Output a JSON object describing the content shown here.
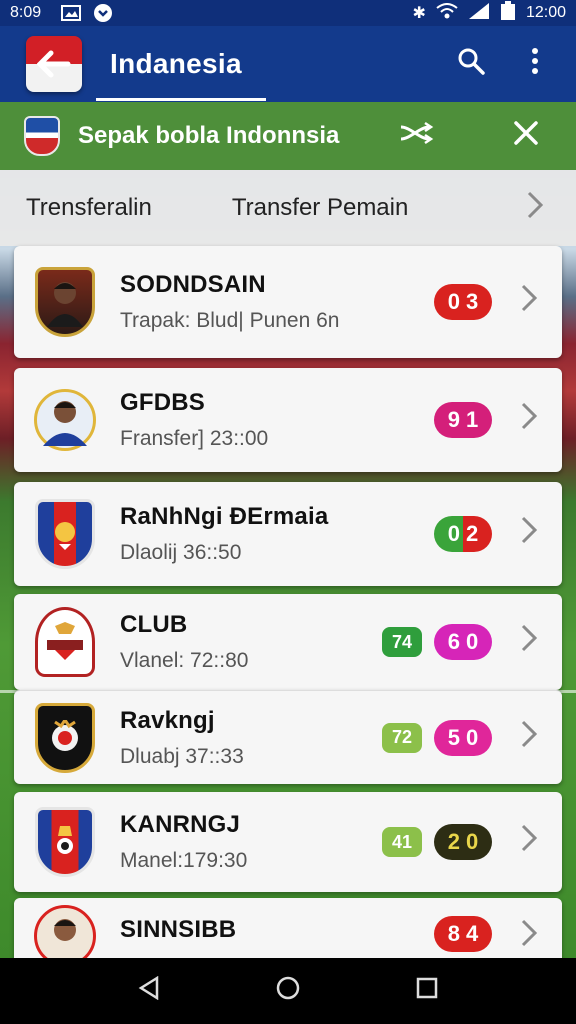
{
  "status_bar": {
    "time": "8:09",
    "clock": "12:00",
    "icons": [
      "gallery-icon",
      "chevron-circle-icon",
      "bluetooth-icon",
      "wifi-icon",
      "signal-icon",
      "battery-icon"
    ]
  },
  "app_bar": {
    "title": "Indanesia",
    "icons": [
      "search-icon",
      "more-vert-icon"
    ]
  },
  "section_header": {
    "title": "Sepak bobla Indonnsia",
    "icons": [
      "shuffle-icon",
      "close-icon"
    ]
  },
  "tabs": {
    "left": "Trensferalin",
    "right": "Transfer Pemain"
  },
  "items": [
    {
      "name": "SODNDSAIN",
      "sub": "Trapak: Blud| Punen 6n",
      "badges": [
        {
          "text": "0 3",
          "color": "#d9221f"
        }
      ],
      "logo": "player-photo"
    },
    {
      "name": "GFDBS",
      "sub": "Fransfer] 23::00",
      "badges": [
        {
          "text": "9 1",
          "color": "#d41f7a"
        }
      ],
      "logo": "player-photo"
    },
    {
      "name": "RaNhNgi ÐErmaia",
      "sub": "Dlaolij 36::50",
      "badges": [
        {
          "text": "0 2",
          "color": "#3aa43a",
          "split_color": "#d9221f"
        }
      ],
      "logo": "club-crest"
    },
    {
      "name": "CLUB",
      "sub": "Vlanel: 72::80",
      "badges": [
        {
          "text": "74",
          "color": "#2f9e3c",
          "small": true
        },
        {
          "text": "6 0",
          "color": "#d625b8"
        }
      ],
      "logo": "club-crest"
    },
    {
      "name": "Ravkngj",
      "sub": "Dluabj 37::33",
      "badges": [
        {
          "text": "72",
          "color": "#8cc04a",
          "small": true
        },
        {
          "text": "5 0",
          "color": "#e0269a"
        }
      ],
      "logo": "club-crest"
    },
    {
      "name": "KANRNGJ",
      "sub": "Manel:179:30",
      "badges": [
        {
          "text": "41",
          "color": "#8cc04a",
          "small": true
        },
        {
          "text": "2 0",
          "color": "#2d2d14",
          "text_color": "#e9d64b"
        }
      ],
      "logo": "club-crest"
    },
    {
      "name": "SINNSIBB",
      "sub": "",
      "badges": [
        {
          "text": "8 4",
          "color": "#d9221f"
        }
      ],
      "logo": "player-photo"
    }
  ],
  "nav": [
    "back-icon",
    "home-icon",
    "recents-icon"
  ]
}
